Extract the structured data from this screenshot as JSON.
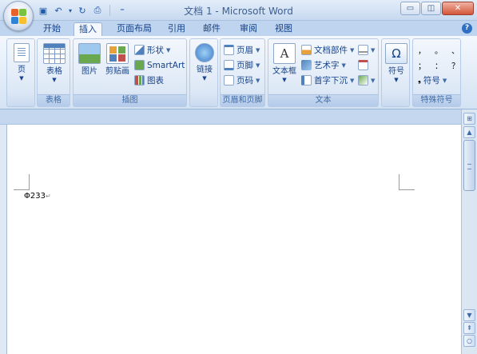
{
  "window": {
    "title": "文档 1 - Microsoft Word",
    "controls": {
      "minimize": "▭",
      "restore": "◫",
      "close": "✕"
    }
  },
  "quick_access": {
    "items": [
      {
        "icon": "save-icon",
        "glyph": "▣"
      },
      {
        "icon": "undo-icon",
        "glyph": "↶"
      },
      {
        "icon": "dropdown-icon",
        "glyph": "▾"
      },
      {
        "icon": "redo-icon",
        "glyph": "↻"
      },
      {
        "icon": "print-preview-icon",
        "glyph": "⎙"
      },
      {
        "icon": "customize-icon",
        "glyph": "⁼"
      }
    ]
  },
  "tabs": [
    {
      "label": "开始",
      "active": false
    },
    {
      "label": "插入",
      "active": true
    },
    {
      "label": "页面布局",
      "active": false
    },
    {
      "label": "引用",
      "active": false
    },
    {
      "label": "邮件",
      "active": false
    },
    {
      "label": "审阅",
      "active": false
    },
    {
      "label": "视图",
      "active": false
    }
  ],
  "help_glyph": "?",
  "ribbon": {
    "pages_group": {
      "button": "页"
    },
    "table_group": {
      "label": "表格",
      "button": "表格"
    },
    "illustrations_group": {
      "label": "插图",
      "picture": "图片",
      "clipart": "剪贴画",
      "shapes": "形状",
      "smartart": "SmartArt",
      "chart": "图表"
    },
    "links_group": {
      "button": "链接"
    },
    "header_footer_group": {
      "label": "页眉和页脚",
      "header": "页眉",
      "footer": "页脚",
      "page_number": "页码"
    },
    "text_group": {
      "label": "文本",
      "textbox": "文本框",
      "quick_parts": "文档部件",
      "wordart": "艺术字",
      "drop_cap": "首字下沉"
    },
    "symbols_group": {
      "button": "符号"
    },
    "special_symbols_group": {
      "label": "特殊符号",
      "row1": [
        "，",
        "。",
        "、"
      ],
      "row2": [
        "；",
        "：",
        "？"
      ],
      "symbol_button": "符号"
    }
  },
  "document": {
    "text": "Φ233",
    "paragraph_mark": "↵"
  },
  "colors": {
    "ribbon_text": "#15428b",
    "accent": "#2f6fc4"
  }
}
